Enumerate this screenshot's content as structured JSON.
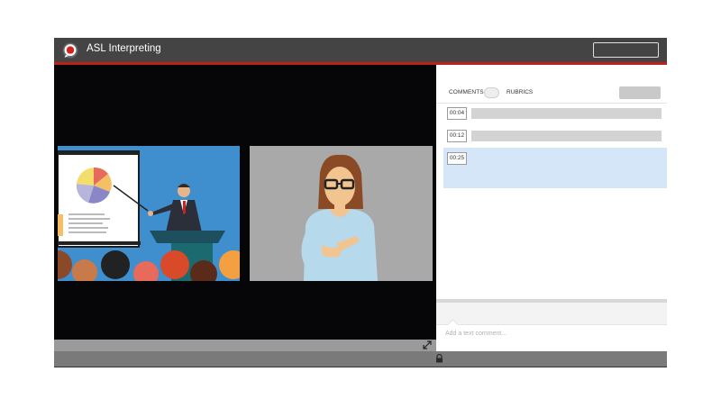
{
  "app": {
    "title": "ASL Interpreting"
  },
  "tabs": {
    "comments_label": "COMMENTS",
    "rubrics_label": "RUBRICS"
  },
  "comments": [
    {
      "time": "00:04"
    },
    {
      "time": "00:12"
    },
    {
      "time": "00:25",
      "selected": true
    }
  ],
  "composer": {
    "placeholder": "Add a text comment..."
  },
  "colors": {
    "accent": "#c0201c",
    "titlebar": "#444444",
    "selected_row": "#d4e6f7"
  },
  "icons": [
    "app-logo-icon",
    "expand-icon",
    "lock-icon"
  ]
}
